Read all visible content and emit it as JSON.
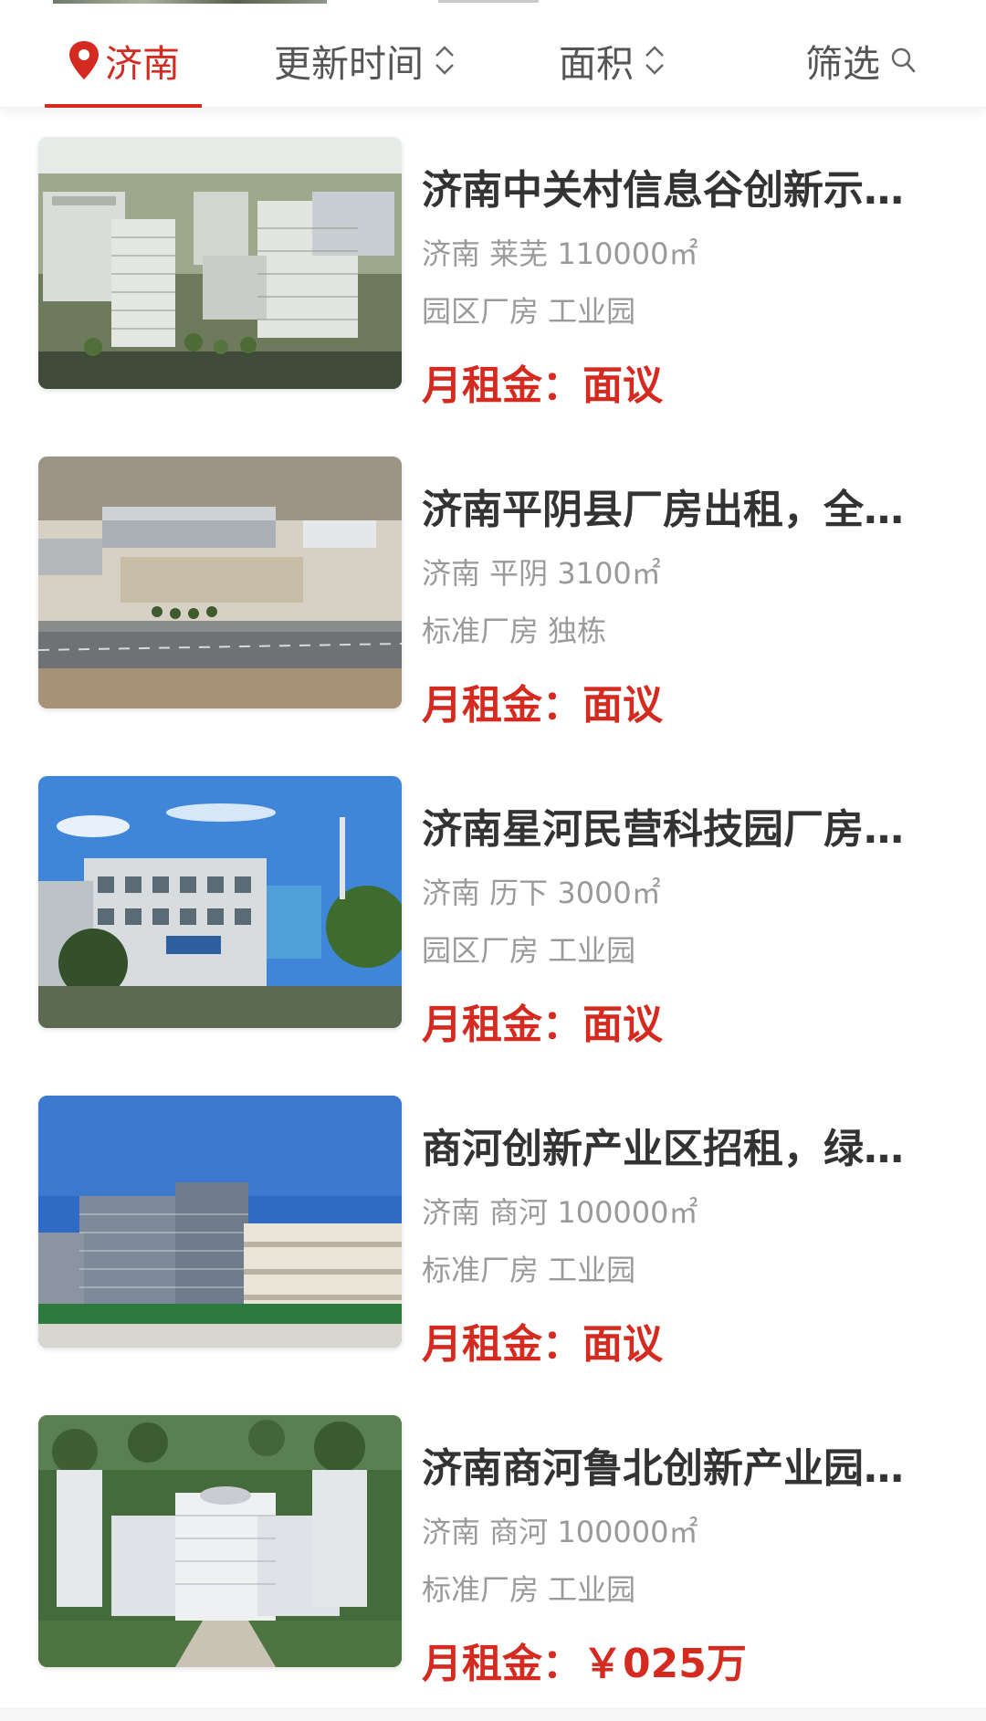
{
  "filters": {
    "city": "济南",
    "update_time": "更新时间",
    "area": "面积",
    "screen": "筛选",
    "accent_color": "#d42a1f"
  },
  "listings": [
    {
      "title": "济南中关村信息谷创新示范区",
      "title_display": "济南中关村信息谷创新示…",
      "meta": "济南 莱芜 110000㎡",
      "tags": "园区厂房 工业园",
      "rent_label": "月租金：",
      "rent_value": "面议",
      "image": "industrial-park-aerial"
    },
    {
      "title_display": "济南平阴县厂房出租，全…",
      "meta": "济南 平阴 3100㎡",
      "tags": "标准厂房 独栋",
      "rent_label": "月租金：",
      "rent_value": "面议",
      "image": "factory-aerial-road"
    },
    {
      "title_display": "济南星河民营科技园厂房…",
      "meta": "济南 历下 3000㎡",
      "tags": "园区厂房 工业园",
      "rent_label": "月租金：",
      "rent_value": "面议",
      "image": "office-building-blue-sky"
    },
    {
      "title_display": "商河创新产业区招租，绿…",
      "meta": "济南 商河 100000㎡",
      "tags": "标准厂房 工业园",
      "rent_label": "月租金：",
      "rent_value": "面议",
      "image": "industrial-buildings-blue-sky"
    },
    {
      "title_display": "济南商河鲁北创新产业园…",
      "meta": "济南 商河 100000㎡",
      "tags": "标准厂房 工业园",
      "rent_label": "月租金：",
      "rent_value": "￥025万",
      "image": "innovation-park-aerial-render"
    }
  ]
}
